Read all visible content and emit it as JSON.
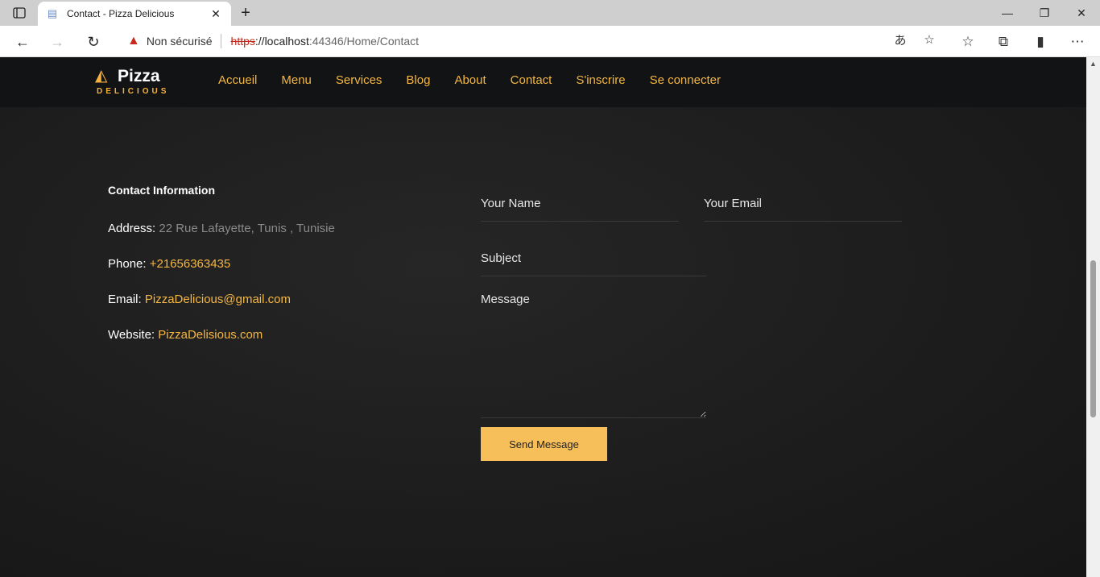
{
  "browser": {
    "tab_title": "Contact - Pizza Delicious",
    "security_label": "Non sécurisé",
    "url_scheme": "https",
    "url_host": "://localhost",
    "url_path": ":44346/Home/Contact"
  },
  "site": {
    "logo_word1": "Pizza",
    "logo_word2": "DELICIOUS",
    "nav": [
      "Accueil",
      "Menu",
      "Services",
      "Blog",
      "About",
      "Contact",
      "S'inscrire",
      "Se connecter"
    ]
  },
  "contact_info": {
    "title": "Contact Information",
    "address_label": "Address:",
    "address_value": "22 Rue Lafayette, Tunis , Tunisie",
    "phone_label": "Phone:",
    "phone_value": "+21656363435",
    "email_label": "Email:",
    "email_value": "PizzaDelicious@gmail.com",
    "website_label": "Website:",
    "website_value": "PizzaDelisious.com"
  },
  "form": {
    "name_placeholder": "Your Name",
    "email_placeholder": "Your Email",
    "subject_placeholder": "Subject",
    "message_placeholder": "Message",
    "send_label": "Send Message"
  },
  "colors": {
    "accent": "#f5b742",
    "button": "#f6bf5a",
    "nav_bg": "#121315"
  }
}
